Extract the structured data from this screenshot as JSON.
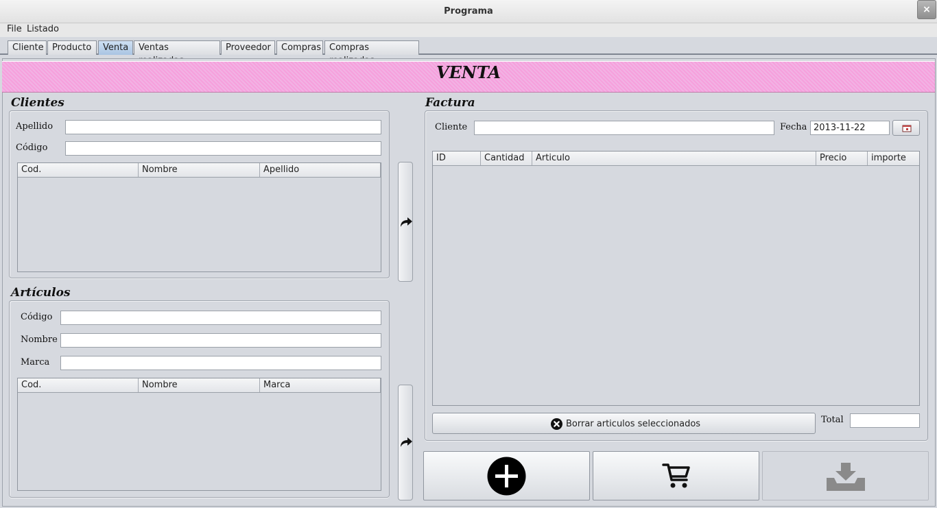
{
  "window": {
    "title": "Programa",
    "close_glyph": "×"
  },
  "menu": {
    "file": "File",
    "listado": "Listado"
  },
  "tabs": [
    {
      "label": "Cliente"
    },
    {
      "label": "Producto"
    },
    {
      "label": "Venta",
      "active": true
    },
    {
      "label": "Ventas realizadas"
    },
    {
      "label": "Proveedor"
    },
    {
      "label": "Compras"
    },
    {
      "label": "Compras realizadas"
    }
  ],
  "banner": {
    "title": "VENTA",
    "color": "#f6a0dc"
  },
  "clientes": {
    "title": "Clientes",
    "apellido_label": "Apellido",
    "apellido_value": "",
    "codigo_label": "Código",
    "codigo_value": "",
    "columns": [
      "Cod.",
      "Nombre",
      "Apellido"
    ]
  },
  "articulos": {
    "title": "Artículos",
    "codigo_label": "Código",
    "codigo_value": "",
    "nombre_label": "Nombre",
    "nombre_value": "",
    "marca_label": "Marca",
    "marca_value": "",
    "columns": [
      "Cod.",
      "Nombre",
      "Marca"
    ]
  },
  "factura": {
    "title": "Factura",
    "cliente_label": "Cliente",
    "cliente_value": "",
    "fecha_label": "Fecha",
    "fecha_value": "2013-11-22",
    "columns": [
      "ID",
      "Cantidad",
      "Articulo",
      "Precio",
      "importe"
    ],
    "delete_button": "Borrar articulos seleccionados",
    "total_label": "Total",
    "total_value": ""
  },
  "icons": {
    "transfer_cliente": "share-arrow-icon",
    "transfer_articulo": "share-arrow-icon",
    "calendar": "calendar-icon",
    "delete": "circle-x-icon",
    "add": "plus-circle-icon",
    "cart": "cart-icon",
    "save": "download-tray-icon"
  }
}
